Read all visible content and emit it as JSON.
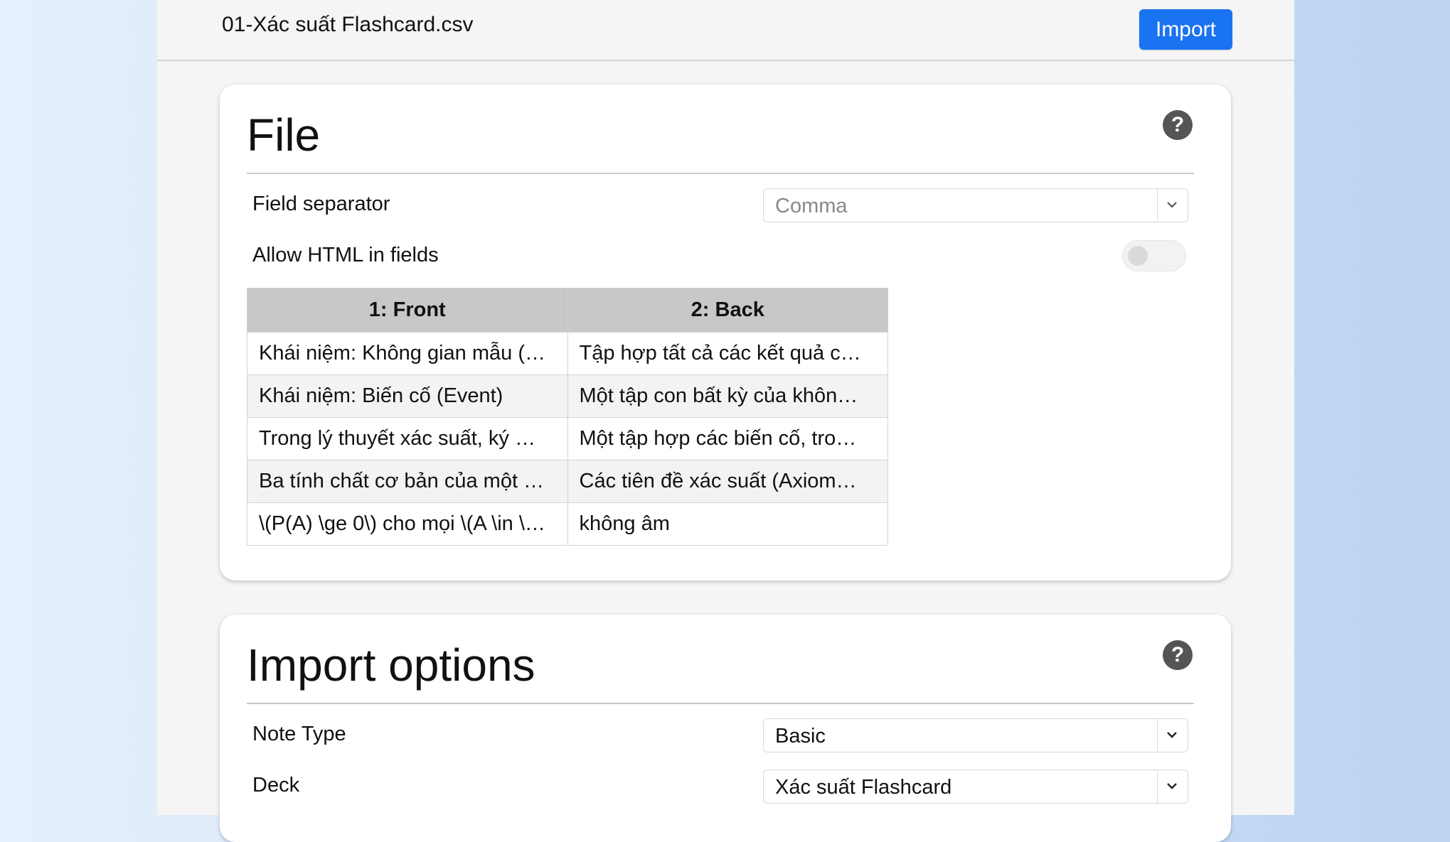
{
  "header": {
    "filename": "01-Xác suất Flashcard.csv",
    "import_label": "Import"
  },
  "file_section": {
    "title": "File",
    "help": "?",
    "field_separator_label": "Field separator",
    "field_separator_value": "Comma",
    "allow_html_label": "Allow HTML in fields",
    "allow_html_enabled": false,
    "columns": [
      "1: Front",
      "2: Back"
    ],
    "rows": [
      [
        "Khái niệm: Không gian mẫu (…",
        "Tập hợp tất cả các kết quả c…"
      ],
      [
        "Khái niệm: Biến cố (Event)",
        "Một tập con bất kỳ của khôn…"
      ],
      [
        "Trong lý thuyết xác suất, ký …",
        "Một tập hợp các biến cố, tro…"
      ],
      [
        "Ba tính chất cơ bản của một …",
        "Các tiên đề xác suất (Axiom…"
      ],
      [
        "\\(P(A) \\ge 0\\) cho mọi \\(A \\in \\…",
        "không âm"
      ]
    ]
  },
  "options_section": {
    "title": "Import options",
    "help": "?",
    "note_type_label": "Note Type",
    "note_type_value": "Basic",
    "deck_label": "Deck",
    "deck_value": "Xác suất Flashcard"
  }
}
